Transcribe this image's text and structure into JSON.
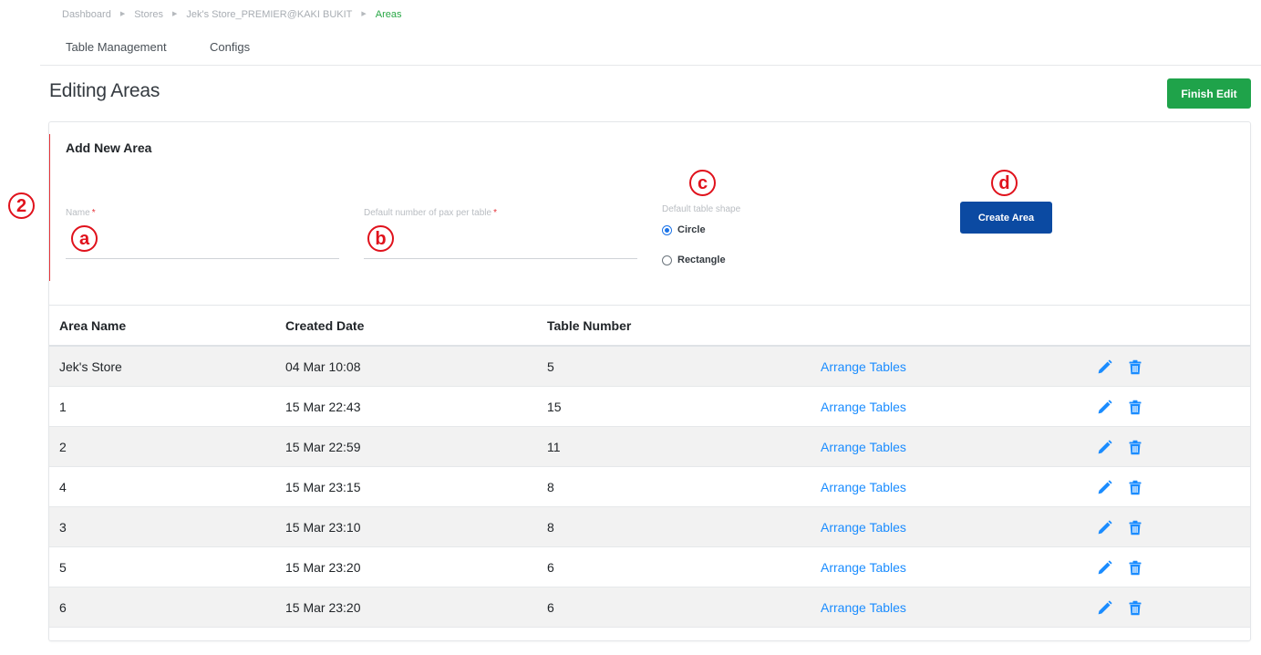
{
  "breadcrumb": {
    "items": [
      "Dashboard",
      "Stores",
      "Jek's Store_PREMIER@KAKI BUKIT",
      "Areas"
    ]
  },
  "tabs": [
    "Table Management",
    "Configs"
  ],
  "header": {
    "title": "Editing Areas",
    "finish_label": "Finish Edit"
  },
  "form": {
    "title": "Add New Area",
    "name_label": "Name",
    "pax_label": "Default number of pax per table",
    "required_mark": "*",
    "shape_label": "Default table shape",
    "shape_options": [
      {
        "label": "Circle",
        "checked": true
      },
      {
        "label": "Rectangle",
        "checked": false
      }
    ],
    "create_label": "Create Area"
  },
  "annotations": {
    "section": "2",
    "name": "a",
    "pax": "b",
    "shape": "c",
    "create": "d"
  },
  "table": {
    "headers": [
      "Area Name",
      "Created Date",
      "Table Number"
    ],
    "action_label": "Arrange Tables",
    "rows": [
      {
        "name": "Jek's Store",
        "date": "04 Mar 10:08",
        "tables": "5"
      },
      {
        "name": "1",
        "date": "15 Mar 22:43",
        "tables": "15"
      },
      {
        "name": "2",
        "date": "15 Mar 22:59",
        "tables": "11"
      },
      {
        "name": "4",
        "date": "15 Mar 23:15",
        "tables": "8"
      },
      {
        "name": "3",
        "date": "15 Mar 23:10",
        "tables": "8"
      },
      {
        "name": "5",
        "date": "15 Mar 23:20",
        "tables": "6"
      },
      {
        "name": "6",
        "date": "15 Mar 23:20",
        "tables": "6"
      }
    ]
  },
  "icons": {
    "edit": "pencil-icon",
    "delete": "trash-icon",
    "breadcrumb_separator": "triangle-right-icon"
  },
  "colors": {
    "finish_button": "#1fa34a",
    "create_button": "#0b4aa2",
    "link": "#1a8cff",
    "annotation": "#e0121c",
    "active_breadcrumb": "#28a745"
  }
}
